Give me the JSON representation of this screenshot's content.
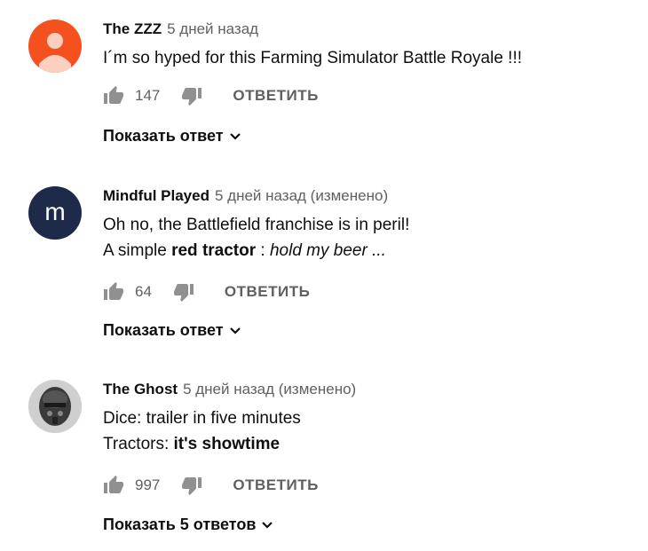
{
  "comments": [
    {
      "author": "The ZZZ",
      "time": "5 дней назад",
      "line1": "I´m so hyped for this Farming Simulator Battle Royale !!!",
      "likes": "147",
      "reply": "ОТВЕТИТЬ",
      "show_replies": "Показать ответ",
      "avatar_color": "#f4511e"
    },
    {
      "author": "Mindful Played",
      "time": "5 дней назад (изменено)",
      "line1": "Oh no, the Battlefield franchise is in peril!",
      "line2_a": "A simple ",
      "line2_b": "red tractor",
      "line2_c": " :  ",
      "line2_d": "hold my beer ...",
      "likes": "64",
      "reply": "ОТВЕТИТЬ",
      "show_replies": "Показать ответ",
      "avatar_color": "#1e2a4a",
      "avatar_letter": "m"
    },
    {
      "author": "The Ghost",
      "time": "5 дней назад (изменено)",
      "line1": "Dice: trailer in five minutes",
      "line2_a": "Tractors: ",
      "line2_b": "it's showtime",
      "likes": "997",
      "reply": "ОТВЕТИТЬ",
      "show_replies": "Показать 5 ответов"
    }
  ]
}
